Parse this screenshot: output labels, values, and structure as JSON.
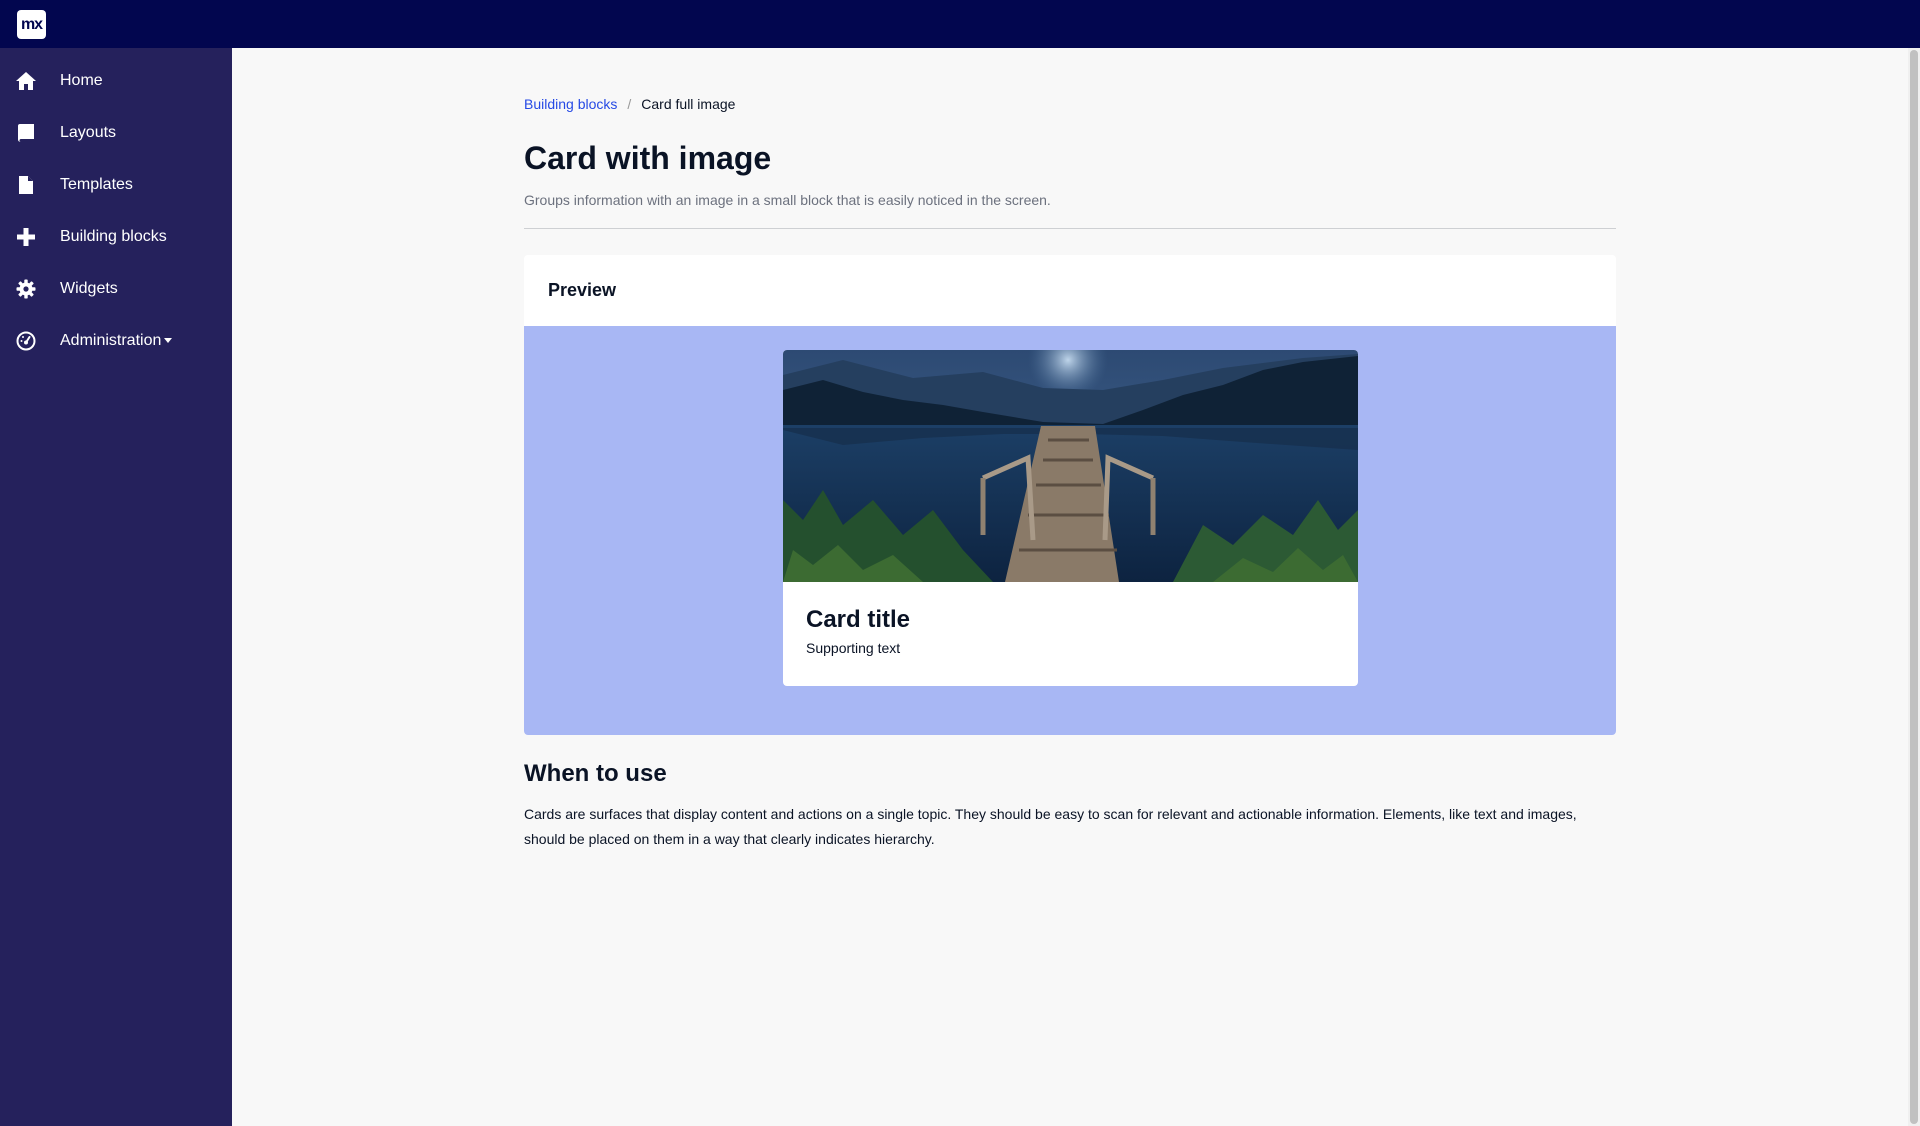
{
  "app": {
    "logo_text": "mx"
  },
  "sidebar": {
    "items": [
      {
        "label": "Home",
        "icon": "home-icon"
      },
      {
        "label": "Layouts",
        "icon": "book-icon"
      },
      {
        "label": "Templates",
        "icon": "file-icon"
      },
      {
        "label": "Building blocks",
        "icon": "plus-icon"
      },
      {
        "label": "Widgets",
        "icon": "gear-icon"
      },
      {
        "label": "Administration",
        "icon": "dashboard-icon",
        "has_dropdown": true
      }
    ]
  },
  "breadcrumb": {
    "parent": "Building blocks",
    "separator": "/",
    "current": "Card full image"
  },
  "page": {
    "title": "Card with image",
    "subtitle": "Groups information with an image in a small block that is easily noticed in the screen."
  },
  "preview": {
    "header": "Preview",
    "card_title": "Card title",
    "card_text": "Supporting text"
  },
  "when_to_use": {
    "title": "When to use",
    "text": "Cards are surfaces that display content and actions on a single topic. They should be easy to scan for relevant and actionable information. Elements, like text and images, should be placed on them in a way that clearly indicates hierarchy."
  },
  "colors": {
    "topbar": "#02064f",
    "sidebar": "#25215c",
    "link": "#264ae5",
    "preview_stage": "#a8b7f4"
  }
}
